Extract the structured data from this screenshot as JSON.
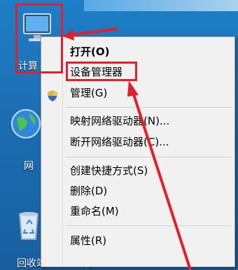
{
  "desktop": {
    "icons": [
      {
        "label": "计算",
        "name": "computer"
      },
      {
        "label": "网",
        "name": "network"
      },
      {
        "label": "回收站",
        "name": "recycle-bin"
      }
    ],
    "right_fragment": "网"
  },
  "context_menu": {
    "items": [
      {
        "label": "打开(O)",
        "bold": true
      },
      {
        "label": "设备管理器",
        "highlighted": true
      },
      {
        "label": "管理(G)",
        "icon": "shield-icon"
      },
      {
        "label": "映射网络驱动器(N)..."
      },
      {
        "label": "断开网络驱动器(C)..."
      },
      {
        "label": "创建快捷方式(S)"
      },
      {
        "label": "删除(D)"
      },
      {
        "label": "重命名(M)"
      },
      {
        "label": "属性(R)"
      }
    ]
  },
  "colors": {
    "annotation_red": "#e21f2a",
    "desktop_blue": "#1f73b9",
    "menu_bg": "#f1f1f1"
  }
}
